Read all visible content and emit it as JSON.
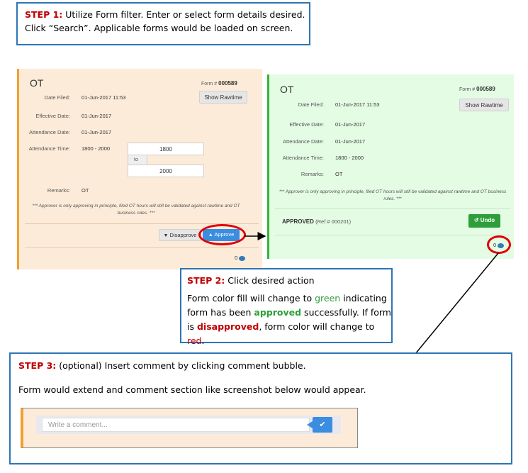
{
  "step1": {
    "label": "STEP 1:",
    "text_line1": "Utilize Form filter. Enter or select form details desired.",
    "text_line2": "Click “Search”. Applicable forms would be loaded on screen."
  },
  "form_pending": {
    "title": "OT",
    "form_no_label": "Form #",
    "form_no": "000589",
    "show_rawtime": "Show Rawtime",
    "date_filed_label": "Date Filed:",
    "date_filed": "01-Jun-2017 11:53",
    "effective_date_label": "Effective Date:",
    "effective_date": "01-Jun-2017",
    "attendance_date_label": "Attendance Date:",
    "attendance_date": "01-Jun-2017",
    "attendance_time_label": "Attendance Time:",
    "attendance_time": "1800 - 2000",
    "time_from": "1800",
    "time_to_label": "to",
    "time_to": "2000",
    "remarks_label": "Remarks:",
    "remarks": "OT",
    "footnote": "*** Approver is only approving in principle, filed OT hours will still be validated against rawtime and OT business rules. ***",
    "disapprove": "Disapprove",
    "approve": "Approve",
    "comment_count": "0"
  },
  "form_approved": {
    "title": "OT",
    "form_no_label": "Form #",
    "form_no": "000589",
    "show_rawtime": "Show Rawtime",
    "date_filed_label": "Date Filed:",
    "date_filed": "01-Jun-2017 11:53",
    "effective_date_label": "Effective Date:",
    "effective_date": "01-Jun-2017",
    "attendance_date_label": "Attendance Date:",
    "attendance_date": "01-Jun-2017",
    "attendance_time_label": "Attendance Time:",
    "attendance_time": "1800 - 2000",
    "remarks_label": "Remarks:",
    "remarks": "OT",
    "footnote": "*** Approver is only approving in principle, filed OT hours will still be validated against rawtime and OT business rules. ***",
    "status": "APPROVED",
    "ref": "(Ref # 000201)",
    "undo": "Undo",
    "comment_count": "0"
  },
  "step2": {
    "label": "STEP 2:",
    "heading": "Click desired action",
    "p1": "Form color fill will change to ",
    "w_green": "green",
    "p2": " indicating",
    "p3": "form has been ",
    "w_approved": "approved",
    "p4": " successfully. If form",
    "p5": "is ",
    "w_disapproved": "disapproved",
    "p6": ", form color will change to ",
    "w_red": "red",
    "p7": "."
  },
  "step3": {
    "label": "STEP 3:",
    "heading": "(optional) Insert comment by clicking comment bubble.",
    "text": "Form would extend and comment section like screenshot below would appear.",
    "comment_placeholder": "Write a comment..."
  },
  "colors": {
    "pending_bg": "#fdebd9",
    "pending_accent": "#f0a030",
    "approved_bg": "#e4fbe4",
    "approved_accent": "#35b435",
    "approve_btn": "#3b8de0",
    "undo_btn": "#2e9e3a",
    "highlight": "#e00000",
    "note_border": "#2e75b6"
  }
}
